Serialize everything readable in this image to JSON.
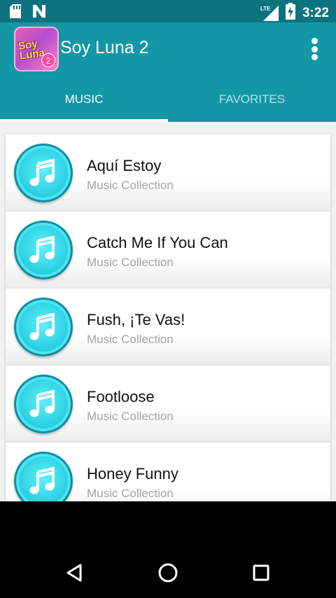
{
  "status_bar": {
    "time": "3:22",
    "network": "LTE",
    "left_icons": [
      "sd-card-icon",
      "n-notification-icon"
    ],
    "right_icons": [
      "lte-signal-icon",
      "battery-charging-icon"
    ]
  },
  "app_bar": {
    "title": "Soy Luna 2",
    "logo_text": "Soy Luna",
    "logo_badge": "2",
    "logo_icon": "app-logo-icon",
    "overflow_icon": "overflow-menu-icon"
  },
  "tabs": [
    {
      "label": "MUSIC",
      "active": true
    },
    {
      "label": "FAVORITES",
      "active": false
    }
  ],
  "songs": [
    {
      "title": "Aquí Estoy",
      "subtitle": "Music Collection"
    },
    {
      "title": "Catch Me If You Can",
      "subtitle": "Music Collection"
    },
    {
      "title": "Fush, ¡Te Vas!",
      "subtitle": "Music Collection"
    },
    {
      "title": "Footloose",
      "subtitle": "Music Collection"
    },
    {
      "title": "Honey Funny",
      "subtitle": "Music Collection"
    }
  ],
  "nav_bar": {
    "back_icon": "back-triangle-icon",
    "home_icon": "home-circle-icon",
    "recents_icon": "recents-square-icon"
  },
  "colors": {
    "status_bar": "#0e7380",
    "app_bar": "#1297a6",
    "inactive_tab": "#b6e2e7",
    "disc": "#34d6e8"
  }
}
